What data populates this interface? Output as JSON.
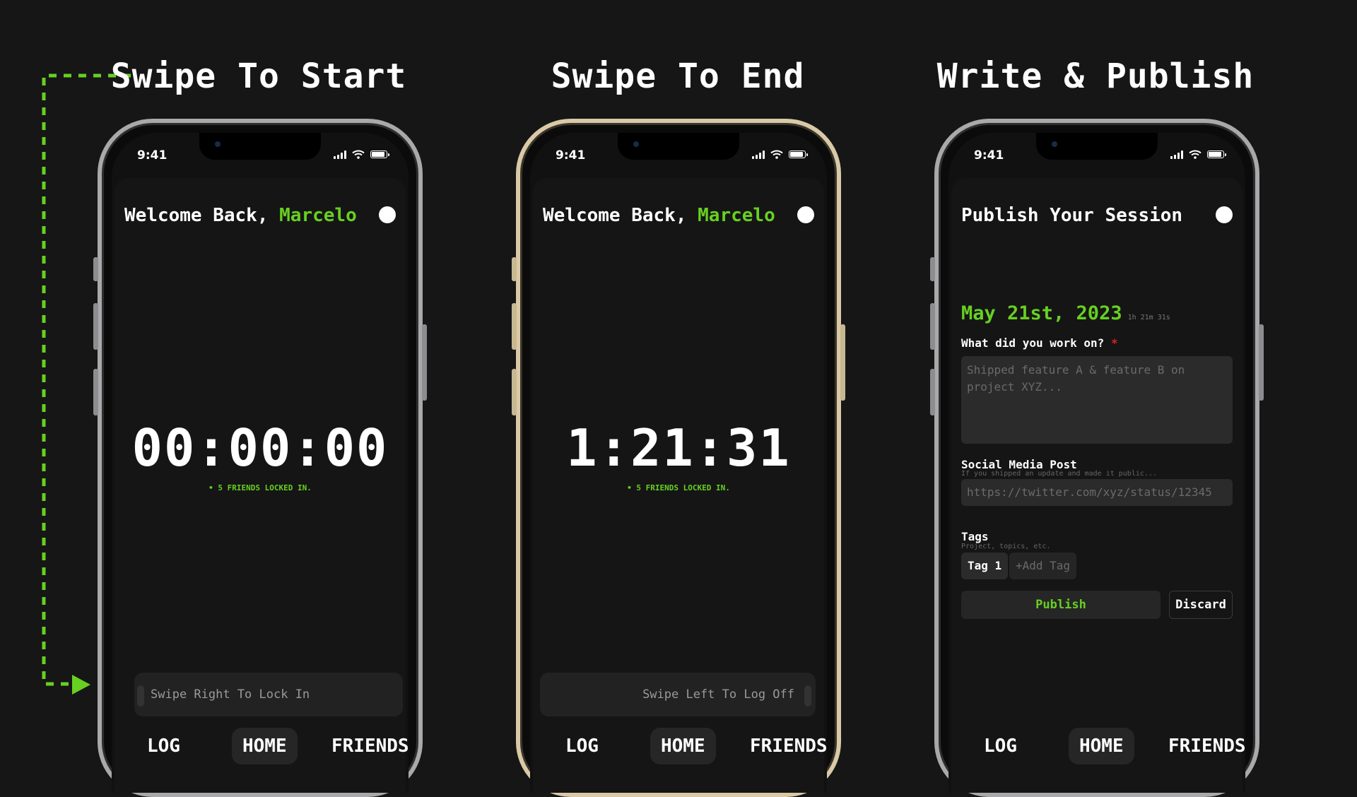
{
  "panels": [
    {
      "title": "Swipe To Start",
      "status_time": "9:41",
      "greeting_prefix": "Welcome Back, ",
      "user_name": "Marcelo",
      "timer": "00:00:00",
      "friends_note": "• 5 FRIENDS LOCKED IN.",
      "swipe_label": "Swipe Right To Lock In",
      "nav": [
        "LOG",
        "HOME",
        "FRIENDS"
      ]
    },
    {
      "title": "Swipe To End",
      "status_time": "9:41",
      "greeting_prefix": "Welcome Back, ",
      "user_name": "Marcelo",
      "timer": "1:21:31",
      "friends_note": "• 5 FRIENDS LOCKED IN.",
      "swipe_label": "Swipe Left To Log Off",
      "nav": [
        "LOG",
        "HOME",
        "FRIENDS"
      ]
    },
    {
      "title": "Write & Publish",
      "status_time": "9:41",
      "heading": "Publish Your Session",
      "date": "May 21st, 2023",
      "duration": "1h 21m 31s",
      "work_label": "What did you work on?",
      "required_mark": "*",
      "work_placeholder": "Shipped feature A & feature B on project XYZ...",
      "social_label": "Social Media Post",
      "social_hint": "If you shipped an update and made it public...",
      "social_placeholder": "https://twitter.com/xyz/status/12345",
      "tags_label": "Tags",
      "tags_hint": "Project, topics, etc.",
      "tags": [
        "Tag 1"
      ],
      "add_tag": "+Add Tag",
      "publish": "Publish",
      "discard": "Discard",
      "nav": [
        "LOG",
        "HOME",
        "FRIENDS"
      ]
    }
  ],
  "active_nav": "HOME",
  "colors": {
    "background": "#161616",
    "accent": "#67d021",
    "frame_silver": "#a9a9ab",
    "frame_gold": "#d9c9a6",
    "required": "#e02020"
  },
  "icons": [
    "signal-icon",
    "wifi-icon",
    "battery-icon",
    "profile-icon",
    "arrow-right-icon"
  ]
}
